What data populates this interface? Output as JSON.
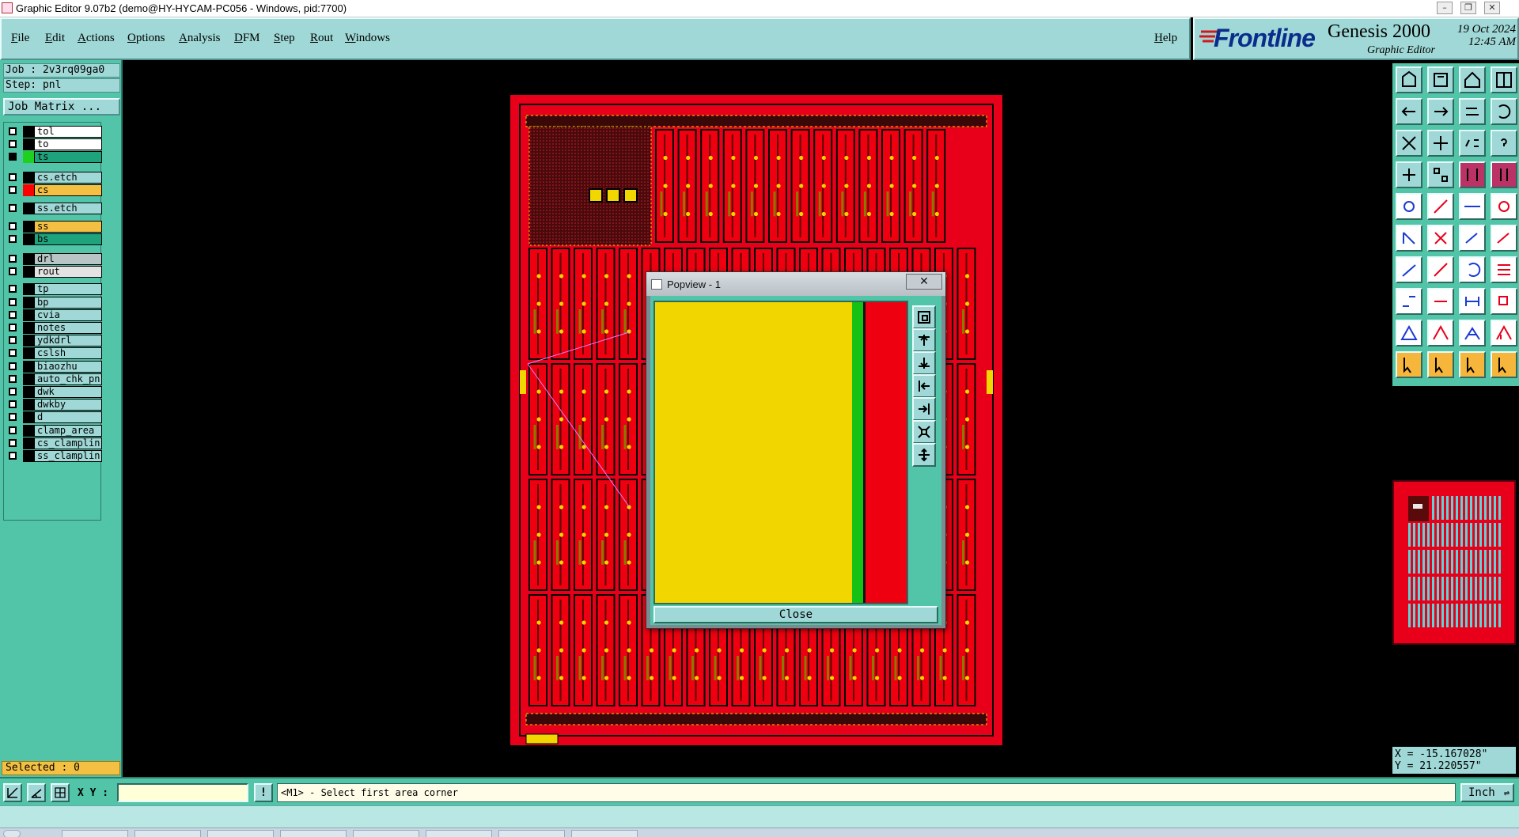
{
  "window": {
    "title": "Graphic Editor 9.07b2 (demo@HY-HYCAM-PC056 - Windows, pid:7700)"
  },
  "menu": {
    "items": [
      "File",
      "Edit",
      "Actions",
      "Options",
      "Analysis",
      "DFM",
      "Step",
      "Rout",
      "Windows"
    ],
    "help": "Help"
  },
  "brand": {
    "logo": "Frontline",
    "product": "Genesis 2000",
    "subtitle": "Graphic Editor",
    "date": "19 Oct 2024",
    "time": "12:45 AM"
  },
  "left": {
    "job": "Job : 2v3rq09ga0",
    "step": "Step: pnl",
    "job_matrix": "Job Matrix ...",
    "layers": [
      {
        "name": "tol",
        "color": "#000000",
        "bg": "#ffffff",
        "checked": false
      },
      {
        "name": "to",
        "color": "#000000",
        "bg": "#ffffff",
        "checked": false
      },
      {
        "name": "ts",
        "color": "#1fd11f",
        "bg": "#1fa37c",
        "checked": true
      },
      {
        "name": "cs.etch",
        "color": "#000000",
        "bg": "#9fd8d6",
        "checked": false
      },
      {
        "name": "cs",
        "color": "#ff0000",
        "bg": "#f4c043",
        "checked": false
      },
      {
        "name": "ss.etch",
        "color": "#000000",
        "bg": "#9fd8d6",
        "checked": false
      },
      {
        "name": "ss",
        "color": "#000000",
        "bg": "#f4c043",
        "checked": false
      },
      {
        "name": "bs",
        "color": "#000000",
        "bg": "#1fa37c",
        "checked": false
      },
      {
        "name": "drl",
        "color": "#000000",
        "bg": "#b9c4c4",
        "checked": false
      },
      {
        "name": "rout",
        "color": "#000000",
        "bg": "#e3e3e3",
        "checked": false
      },
      {
        "name": "tp",
        "color": "#000000",
        "bg": "#9fd8d6",
        "checked": false
      },
      {
        "name": "bp",
        "color": "#000000",
        "bg": "#9fd8d6",
        "checked": false
      },
      {
        "name": "cvia",
        "color": "#000000",
        "bg": "#9fd8d6",
        "checked": false
      },
      {
        "name": "notes",
        "color": "#000000",
        "bg": "#9fd8d6",
        "checked": false
      },
      {
        "name": "ydkdrl",
        "color": "#000000",
        "bg": "#9fd8d6",
        "checked": false
      },
      {
        "name": "cslsh",
        "color": "#000000",
        "bg": "#9fd8d6",
        "checked": false
      },
      {
        "name": "biaozhu",
        "color": "#000000",
        "bg": "#9fd8d6",
        "checked": false
      },
      {
        "name": "auto_chk_pn",
        "color": "#000000",
        "bg": "#9fd8d6",
        "checked": false
      },
      {
        "name": "dwk",
        "color": "#000000",
        "bg": "#9fd8d6",
        "checked": false
      },
      {
        "name": "dwkby",
        "color": "#000000",
        "bg": "#9fd8d6",
        "checked": false
      },
      {
        "name": "d",
        "color": "#000000",
        "bg": "#9fd8d6",
        "checked": false
      },
      {
        "name": "clamp_area",
        "color": "#000000",
        "bg": "#9fd8d6",
        "checked": false
      },
      {
        "name": "cs_clamplin",
        "color": "#000000",
        "bg": "#9fd8d6",
        "checked": false
      },
      {
        "name": "ss_clamplin",
        "color": "#000000",
        "bg": "#9fd8d6",
        "checked": false
      }
    ],
    "selected": "Selected : 0"
  },
  "popview": {
    "title": "Popview - 1",
    "close_x": "✕",
    "close_button": "Close",
    "tools": [
      "zoom-window-icon",
      "zoom-home-icon",
      "zoom-in-icon",
      "pan-left-icon",
      "pan-right-icon",
      "zoom-fit-icon",
      "zoom-out-icon"
    ]
  },
  "bottom": {
    "xy_label": "X Y :",
    "xy_value": "",
    "exclaim": "!",
    "prompt": "<M1> - Select first area corner",
    "unit": "Inch"
  },
  "coords": {
    "x": "X = -15.167028\"",
    "y": "Y = 21.220557\""
  },
  "colors": {
    "panel": "#52c4a8",
    "button": "#9fd8d6",
    "board": "#e8001a",
    "yellow": "#f2d600"
  }
}
